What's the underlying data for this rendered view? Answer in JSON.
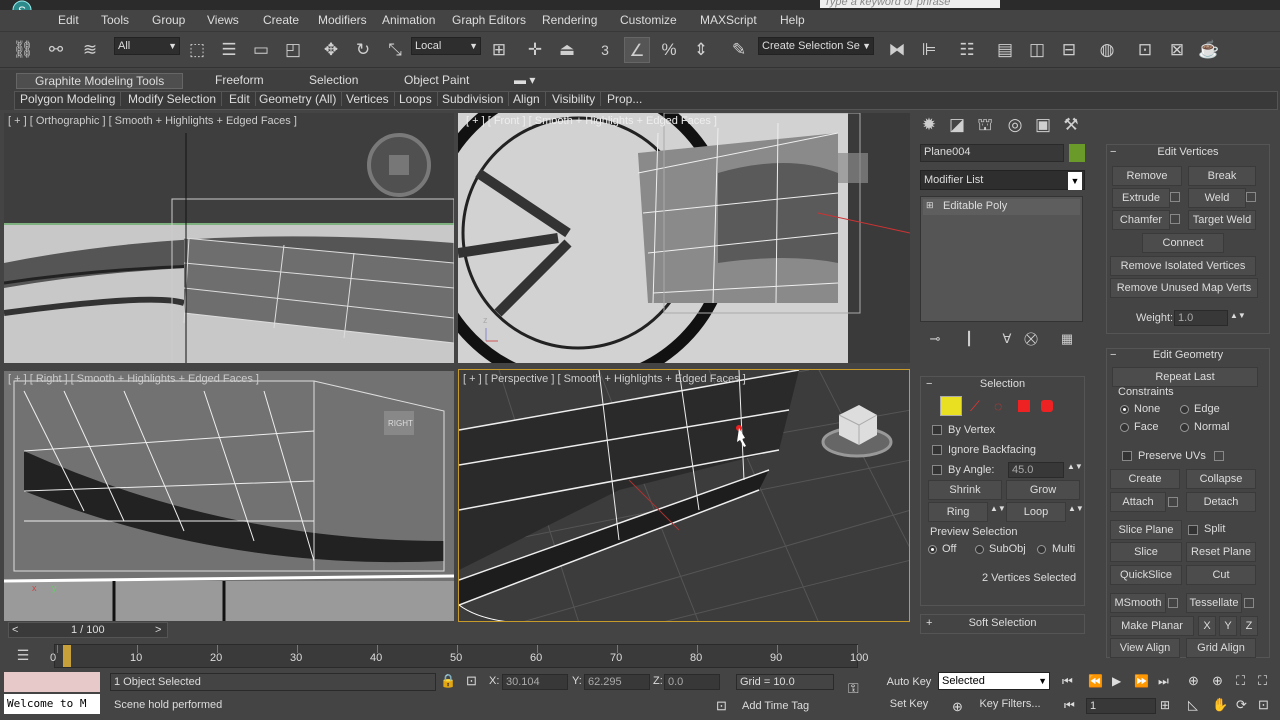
{
  "app": {
    "search_placeholder": "Type a keyword or phrase"
  },
  "menu": [
    "Edit",
    "Tools",
    "Group",
    "Views",
    "Create",
    "Modifiers",
    "Animation",
    "Graph Editors",
    "Rendering",
    "Customize",
    "MAXScript",
    "Help"
  ],
  "toolbar": {
    "filter_value": "All",
    "coord_value": "Local",
    "snap_value": "3",
    "selection_set_placeholder": "Create Selection Se"
  },
  "ribbon": {
    "tabs": [
      "Graphite Modeling Tools",
      "Freeform",
      "Selection",
      "Object Paint"
    ],
    "subtabs": [
      "Polygon Modeling",
      "Modify Selection",
      "Edit",
      "Geometry (All)",
      "Vertices",
      "Loops",
      "Subdivision",
      "Align",
      "Visibility",
      "Prop..."
    ]
  },
  "viewports": {
    "top_left": "[ + ] [ Orthographic ] [ Smooth + Highlights + Edged Faces ]",
    "top_right": "[ + ] [ Front ] [ Smooth + Highlights + Edged Faces ]",
    "bottom_left": "[ + ] [ Right ] [ Smooth + Highlights + Edged Faces ]",
    "bottom_right": "[ + ] [ Perspective ] [ Smooth + Highlights + Edged Faces ]",
    "right_badge": "RIGHT"
  },
  "command_panel": {
    "object_name": "Plane004",
    "object_color": "#6a9a2a",
    "modifier_list": "Modifier List",
    "stack_item": "Editable Poly",
    "selection": {
      "title": "Selection",
      "by_vertex": "By Vertex",
      "ignore_backfacing": "Ignore Backfacing",
      "by_angle": "By Angle:",
      "angle_value": "45.0",
      "shrink": "Shrink",
      "grow": "Grow",
      "ring": "Ring",
      "loop": "Loop",
      "preview_label": "Preview Selection",
      "preview_off": "Off",
      "preview_subobj": "SubObj",
      "preview_multi": "Multi",
      "status": "2 Vertices Selected"
    },
    "soft_selection": "Soft Selection"
  },
  "edit_vertices": {
    "title": "Edit Vertices",
    "remove": "Remove",
    "break": "Break",
    "extrude": "Extrude",
    "weld": "Weld",
    "chamfer": "Chamfer",
    "target_weld": "Target Weld",
    "connect": "Connect",
    "remove_isolated": "Remove Isolated Vertices",
    "remove_unused": "Remove Unused Map Verts",
    "weight_label": "Weight:",
    "weight_value": "1.0"
  },
  "edit_geometry": {
    "title": "Edit Geometry",
    "repeat_last": "Repeat Last",
    "constraints": "Constraints",
    "none": "None",
    "edge": "Edge",
    "face": "Face",
    "normal": "Normal",
    "preserve_uvs": "Preserve UVs",
    "create": "Create",
    "collapse": "Collapse",
    "attach": "Attach",
    "detach": "Detach",
    "slice_plane": "Slice Plane",
    "split": "Split",
    "slice": "Slice",
    "reset_plane": "Reset Plane",
    "quickslice": "QuickSlice",
    "cut": "Cut",
    "msmooth": "MSmooth",
    "tessellate": "Tessellate",
    "make_planar": "Make Planar",
    "x": "X",
    "y": "Y",
    "z": "Z",
    "view_align": "View Align",
    "grid_align": "Grid Align"
  },
  "timeline": {
    "frame_display": "1 / 100",
    "current_frame_fraction": 0.01,
    "ticks": [
      "0",
      "10",
      "20",
      "30",
      "40",
      "50",
      "60",
      "70",
      "80",
      "90",
      "100"
    ]
  },
  "status": {
    "selected": "1 Object Selected",
    "prompt": "Scene hold performed",
    "listener": "Welcome to M",
    "x_label": "X:",
    "x_value": "30.104",
    "y_label": "Y:",
    "y_value": "62.295",
    "z_label": "Z:",
    "z_value": "0.0",
    "grid": "Grid = 10.0",
    "add_time_tag": "Add Time Tag",
    "auto_key": "Auto Key",
    "set_key": "Set Key",
    "key_mode": "Selected",
    "key_filters": "Key Filters...",
    "frame_field": "1"
  }
}
